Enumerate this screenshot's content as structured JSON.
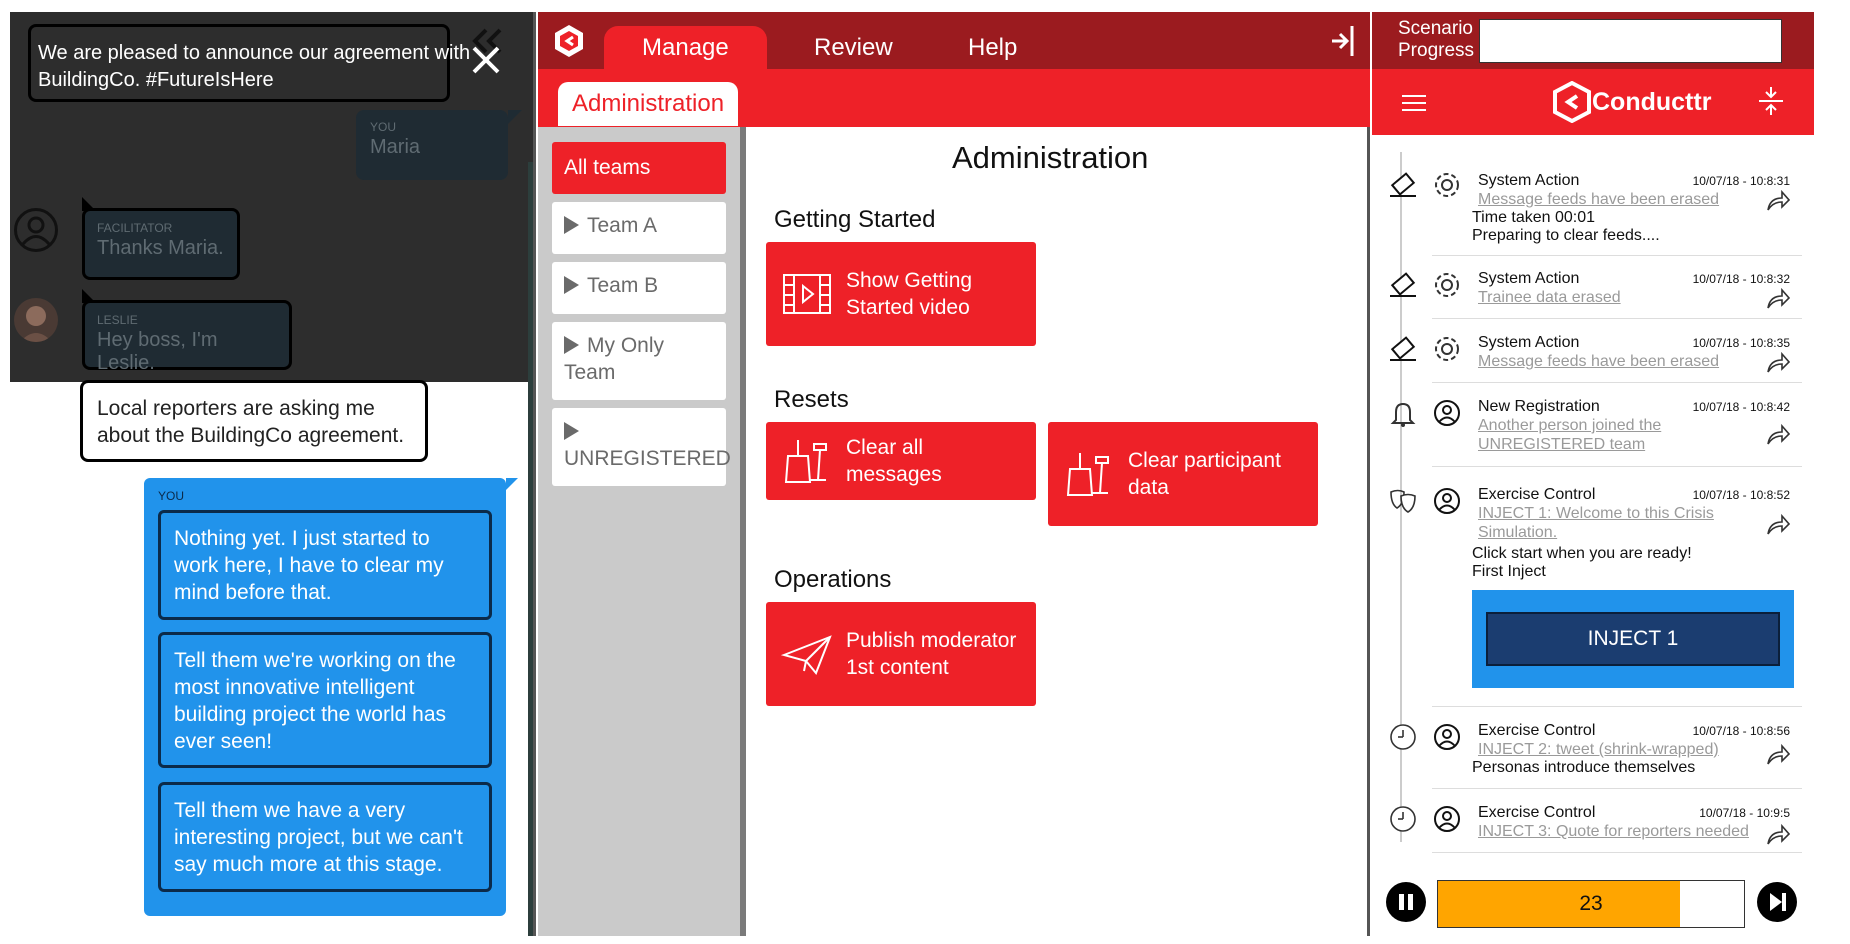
{
  "chat": {
    "announcement": "We are pleased to announce our agreement with BuildingCo. #FutureIsHere",
    "you_faded": {
      "who": "YOU",
      "msg": "Maria"
    },
    "facilitator": {
      "who": "FACILITATOR",
      "msg": "Thanks Maria."
    },
    "leslie": {
      "who": "LESLIE",
      "msg": "Hey boss, I'm Leslie."
    },
    "reporters": "Local reporters are asking me about the BuildingCo agreement.",
    "you_label": "YOU",
    "options": [
      "Nothing yet. I just started to work here, I have to clear my mind before that.",
      "Tell them we're working on the most innovative intelligent building project the world has ever seen!",
      "Tell them we have a very interesting project, but we can't say much more at this stage."
    ]
  },
  "admin": {
    "nav": {
      "manage": "Manage",
      "review": "Review",
      "help": "Help"
    },
    "subtab": "Administration",
    "title": "Administration",
    "teams": [
      "All teams",
      "Team A",
      "Team B",
      "My Only Team",
      "UNREGISTERED"
    ],
    "sections": {
      "getting_started": "Getting Started",
      "resets": "Resets",
      "operations": "Operations"
    },
    "buttons": {
      "show_video": "Show Getting Started video",
      "clear_messages": "Clear all messages",
      "clear_participant": "Clear participant data",
      "publish": "Publish moderator 1st content"
    }
  },
  "timeline": {
    "progress_label": "Scenario Progress",
    "logo": "Conducttr",
    "events": [
      {
        "title": "System Action",
        "time": "10/07/18 - 10:8:31",
        "link": "Message feeds have been erased",
        "lines": [
          "Time taken 00:01",
          "Preparing to clear feeds...."
        ]
      },
      {
        "title": "System Action",
        "time": "10/07/18 - 10:8:32",
        "link": "Trainee data erased",
        "lines": []
      },
      {
        "title": "System Action",
        "time": "10/07/18 - 10:8:35",
        "link": "Message feeds have been erased",
        "lines": []
      },
      {
        "title": "New Registration",
        "time": "10/07/18 - 10:8:42",
        "link": "Another person joined the UNREGISTERED team",
        "lines": []
      },
      {
        "title": "Exercise Control",
        "time": "10/07/18 - 10:8:52",
        "link": "INJECT 1: Welcome to this Crisis Simulation.",
        "lines": [
          "Click start when you are ready!",
          "First Inject"
        ]
      },
      {
        "title": "Exercise Control",
        "time": "10/07/18 - 10:8:56",
        "link": "INJECT 2: tweet (shrink-wrapped)",
        "lines": [
          "Personas introduce themselves"
        ]
      },
      {
        "title": "Exercise Control",
        "time": "10/07/18 - 10:9:5",
        "link": "INJECT 3: Quote for reporters needed",
        "lines": []
      }
    ],
    "inject_button": "INJECT 1",
    "timer": {
      "value": "23",
      "fill": 0.79
    }
  },
  "colors": {
    "red": "#ee2128",
    "dark_red": "#9b1b1f",
    "blue": "#2193eb",
    "navy": "#1b3d70",
    "orange": "#ffa500"
  }
}
